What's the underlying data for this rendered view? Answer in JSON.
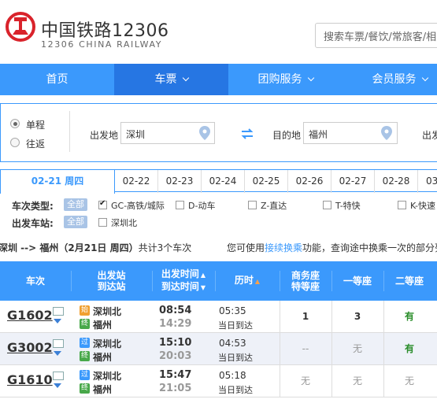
{
  "brand": {
    "cn": "中国铁路12306",
    "en": "12306 CHINA RAILWAY"
  },
  "search": {
    "placeholder": "搜索车票/餐饮/常旅客/相关规章"
  },
  "nav": [
    {
      "label": "首页",
      "has_dropdown": false,
      "active": false
    },
    {
      "label": "车票",
      "has_dropdown": true,
      "active": true
    },
    {
      "label": "团购服务",
      "has_dropdown": true,
      "active": false
    },
    {
      "label": "会员服务",
      "has_dropdown": true,
      "active": false
    }
  ],
  "query": {
    "trip_types": [
      {
        "label": "单程",
        "selected": true
      },
      {
        "label": "往返",
        "selected": false
      }
    ],
    "from_label": "出发地",
    "from_value": "深圳",
    "to_label": "目的地",
    "to_value": "福州",
    "date_label_partial": "出发"
  },
  "dates": [
    {
      "label": "02-21 周四",
      "active": true
    },
    {
      "label": "02-22"
    },
    {
      "label": "02-23"
    },
    {
      "label": "02-24"
    },
    {
      "label": "02-25"
    },
    {
      "label": "02-26"
    },
    {
      "label": "02-27"
    },
    {
      "label": "02-28"
    },
    {
      "label": "03"
    }
  ],
  "filters": {
    "type_label": "车次类型:",
    "all_label": "全部",
    "types": [
      {
        "label": "GC-高铁/城际",
        "checked": true
      },
      {
        "label": "D-动车",
        "checked": false
      },
      {
        "label": "Z-直达",
        "checked": false
      },
      {
        "label": "T-特快",
        "checked": false
      },
      {
        "label": "K-快速",
        "checked": false
      }
    ],
    "station_label": "出发车站:",
    "stations": [
      {
        "label": "深圳北",
        "checked": false
      }
    ]
  },
  "summary": {
    "route": "深圳 --> 福州（2月21日  周四）",
    "count_text": "共计3个车次",
    "hint_prefix": "您可使用",
    "hint_link": "接续换乘",
    "hint_suffix": "功能，查询途中换乘一次的部分列车余票情况。"
  },
  "table": {
    "headers": {
      "train": "车次",
      "stations_top": "出发站",
      "stations_bottom": "到达站",
      "times_top": "出发时间",
      "times_bottom": "到达时间",
      "duration": "历时",
      "business_top": "商务座",
      "business_bottom": "特等座",
      "first": "一等座",
      "second": "二等座"
    },
    "rows": [
      {
        "train": "G1602",
        "from_badge": "始",
        "from": "深圳北",
        "to_badge": "终",
        "to": "福州",
        "depart": "08:54",
        "arrive": "14:29",
        "duration": "05:35",
        "arrive_note": "当日到达",
        "business": "1",
        "first": "3",
        "second": "有"
      },
      {
        "train": "G3002",
        "from_badge": "过",
        "from": "深圳北",
        "to_badge": "终",
        "to": "福州",
        "depart": "15:10",
        "arrive": "20:03",
        "duration": "04:53",
        "arrive_note": "当日到达",
        "business": "--",
        "first": "无",
        "second": "有"
      },
      {
        "train": "G1610",
        "from_badge": "过",
        "from": "深圳北",
        "to_badge": "终",
        "to": "福州",
        "depart": "15:47",
        "arrive": "21:05",
        "duration": "05:18",
        "arrive_note": "当日到达",
        "business": "无",
        "first": "无",
        "second": "无"
      }
    ]
  },
  "colors": {
    "accent": "#3b99fc",
    "nav_active": "#2676e3",
    "brand_red": "#d9232b",
    "available_green": "#2a8d2a",
    "badge_start": "#f0a030",
    "badge_pass": "#3b99fc",
    "badge_end": "#48a84a"
  },
  "icons": {
    "logo": "china-railway-logo",
    "pin": "map-pin-icon",
    "swap": "swap-arrows-icon"
  }
}
